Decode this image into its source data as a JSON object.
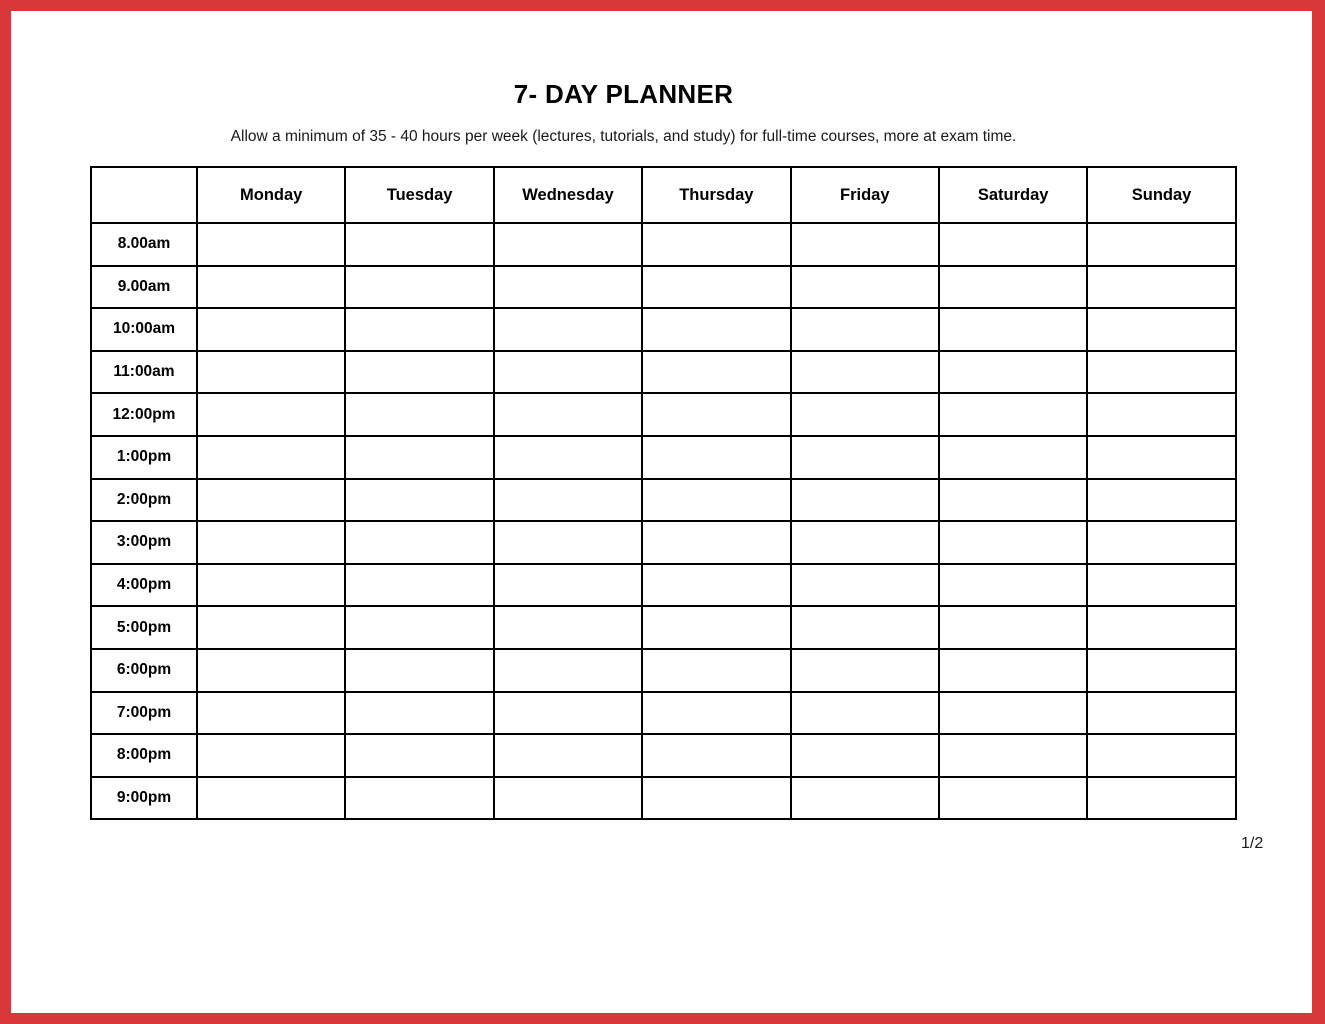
{
  "document": {
    "title": "7- DAY PLANNER",
    "subtitle": "Allow a minimum of 35 - 40 hours per week (lectures, tutorials, and study) for full-time courses, more at exam time.",
    "page_number": "1/2",
    "border_color": "#d8383a",
    "text_color": "#000000",
    "grid_color": "#000000",
    "background_color": "#ffffff"
  },
  "planner": {
    "corner_header": "",
    "day_headers": [
      "Monday",
      "Tuesday",
      "Wednesday",
      "Thursday",
      "Friday",
      "Saturday",
      "Sunday"
    ],
    "time_labels": [
      "8.00am",
      "9.00am",
      "10:00am",
      "11:00am",
      "12:00pm",
      "1:00pm",
      "2:00pm",
      "3:00pm",
      "4:00pm",
      "5:00pm",
      "6:00pm",
      "7:00pm",
      "8:00pm",
      "9:00pm"
    ],
    "cells": [
      [
        "",
        "",
        "",
        "",
        "",
        "",
        ""
      ],
      [
        "",
        "",
        "",
        "",
        "",
        "",
        ""
      ],
      [
        "",
        "",
        "",
        "",
        "",
        "",
        ""
      ],
      [
        "",
        "",
        "",
        "",
        "",
        "",
        ""
      ],
      [
        "",
        "",
        "",
        "",
        "",
        "",
        ""
      ],
      [
        "",
        "",
        "",
        "",
        "",
        "",
        ""
      ],
      [
        "",
        "",
        "",
        "",
        "",
        "",
        ""
      ],
      [
        "",
        "",
        "",
        "",
        "",
        "",
        ""
      ],
      [
        "",
        "",
        "",
        "",
        "",
        "",
        ""
      ],
      [
        "",
        "",
        "",
        "",
        "",
        "",
        ""
      ],
      [
        "",
        "",
        "",
        "",
        "",
        "",
        ""
      ],
      [
        "",
        "",
        "",
        "",
        "",
        "",
        ""
      ],
      [
        "",
        "",
        "",
        "",
        "",
        "",
        ""
      ],
      [
        "",
        "",
        "",
        "",
        "",
        "",
        ""
      ]
    ]
  }
}
